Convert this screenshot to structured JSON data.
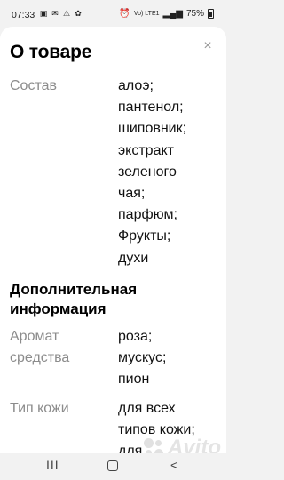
{
  "status_bar": {
    "time": "07:33",
    "notification_icons": [
      "sim-card-icon",
      "mail-icon",
      "warning-icon",
      "flower-icon"
    ],
    "signal_text": "Vo) LTE1",
    "battery": "75%"
  },
  "sheet": {
    "title": "О товаре",
    "close_icon": "×",
    "rows": [
      {
        "label": "Состав",
        "values": [
          "алоэ;",
          "пантенол;",
          "шиповник;",
          "экстракт",
          "зеленого",
          "чая;",
          "парфюм;",
          "Фрукты;",
          "духи"
        ]
      }
    ],
    "section_title": "Дополнительная информация",
    "extra_rows": [
      {
        "label_lines": [
          "Аромат",
          "средства"
        ],
        "values": [
          "роза;",
          "мускус;",
          "пион"
        ]
      },
      {
        "label_lines": [
          "Тип кожи"
        ],
        "values": [
          "для всех",
          "типов кожи;",
          "для"
        ]
      }
    ]
  },
  "watermark": "Avito",
  "nav_bar": {
    "recent_glyph": "III",
    "back_glyph": "<"
  }
}
